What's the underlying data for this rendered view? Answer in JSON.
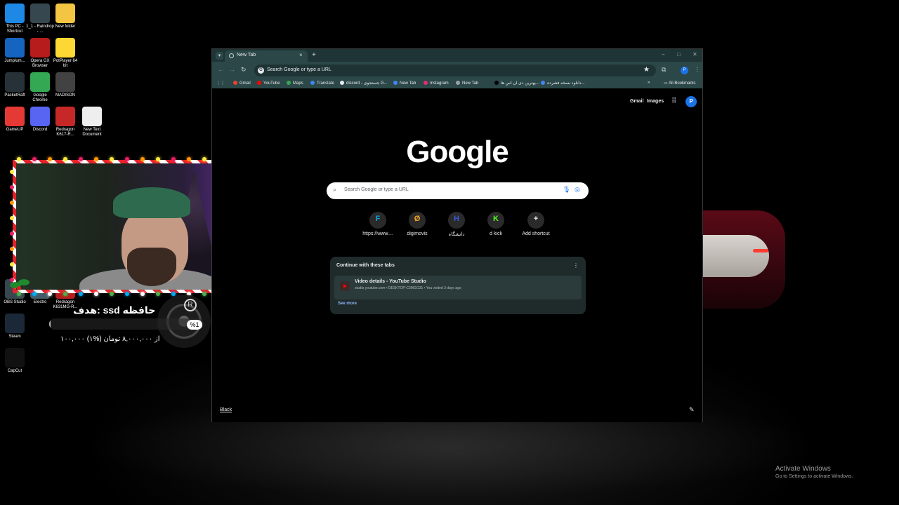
{
  "desktop": {
    "icons": [
      {
        "label": "This PC - Shortcut",
        "color": "#1e88e5"
      },
      {
        "label": "1_1 - Raindrop - ...",
        "color": "#37474f"
      },
      {
        "label": "New folder",
        "color": "#f4c542"
      },
      {
        "label": "Jumplum...",
        "color": "#1565c0"
      },
      {
        "label": "Opera GX Browser",
        "color": "#b71c1c"
      },
      {
        "label": "PotPlayer 64 bit",
        "color": "#fdd835"
      },
      {
        "label": "PacketRaft",
        "color": "#263238"
      },
      {
        "label": "Google Chrome",
        "color": "#34a853"
      },
      {
        "label": "MADISON",
        "color": "#424242"
      },
      {
        "label": "GameUP",
        "color": "#e53935"
      },
      {
        "label": "Discord",
        "color": "#5865f2"
      },
      {
        "label": "Redragon K617-R...",
        "color": "#c62828"
      },
      {
        "label": "New Text Document",
        "color": "#eeeeee"
      },
      {
        "label": "OBS Studio",
        "color": "#37474f"
      },
      {
        "label": "Electro",
        "color": "#455a64"
      },
      {
        "label": "Redragon K631MG-R...",
        "color": "#b71c1c"
      },
      {
        "label": "Steam",
        "color": "#1b2838"
      },
      {
        "label": "CapCut",
        "color": "#111111"
      }
    ],
    "activate_title": "Activate Windows",
    "activate_sub": "Go to Settings to activate Windows."
  },
  "overlay": {
    "goal_title": "هدف: ssd حافظه",
    "goal_percent_label": "%1",
    "goal_progress": 0.01,
    "goal_amount": "۱۰۰,۰۰۰ از ۸,۰۰۰,۰۰۰ تومان (%۱)",
    "rog_logo": "R"
  },
  "chrome": {
    "tab_title": "New Tab",
    "tab_close": "×",
    "newtab_glyph": "+",
    "omnibox_text": "Search Google or type a URL",
    "bookmarks": [
      {
        "label": "Gmail",
        "color": "#ea4335"
      },
      {
        "label": "YouTube",
        "color": "#ff0000"
      },
      {
        "label": "Maps",
        "color": "#34a853"
      },
      {
        "label": "Translate",
        "color": "#4285f4"
      },
      {
        "label": "discord - جستجوی G...",
        "color": "#e8eaed"
      },
      {
        "label": "New Tab",
        "color": "#4285f4"
      },
      {
        "label": "Instagram",
        "color": "#e1306c"
      },
      {
        "label": "New Tab",
        "color": "#9aa0a6"
      },
      {
        "label": "بهترین دی ان اس ها...",
        "color": "#000000"
      },
      {
        "label": "دانلود نسخه فشرده...",
        "color": "#4285f4"
      }
    ],
    "all_bookmarks": "All Bookmarks",
    "profile_initial": "P"
  },
  "ntp": {
    "gmail": "Gmail",
    "images": "Images",
    "avatar": "P",
    "logo": "Google",
    "search_placeholder": "Search Google or type a URL",
    "shortcuts": [
      {
        "label": "https://www....",
        "glyph": "F",
        "color": "#0aa6d6"
      },
      {
        "label": "digimovis",
        "glyph": "Ø",
        "color": "#f5a623"
      },
      {
        "label": "دانشگاه",
        "glyph": "H",
        "color": "#3b5bdb"
      },
      {
        "label": "d kick",
        "glyph": "K",
        "color": "#53fc18"
      },
      {
        "label": "Add shortcut",
        "glyph": "+",
        "color": "#e8eaed"
      }
    ],
    "continue_title": "Continue with these tabs",
    "continue_item_title": "Video details - YouTube Studio",
    "continue_item_sub": "studio.youtube.com • DESKTOP-C3MGG31 • You visited 3 days ago",
    "see_more": "See more",
    "background_name": "Black"
  }
}
